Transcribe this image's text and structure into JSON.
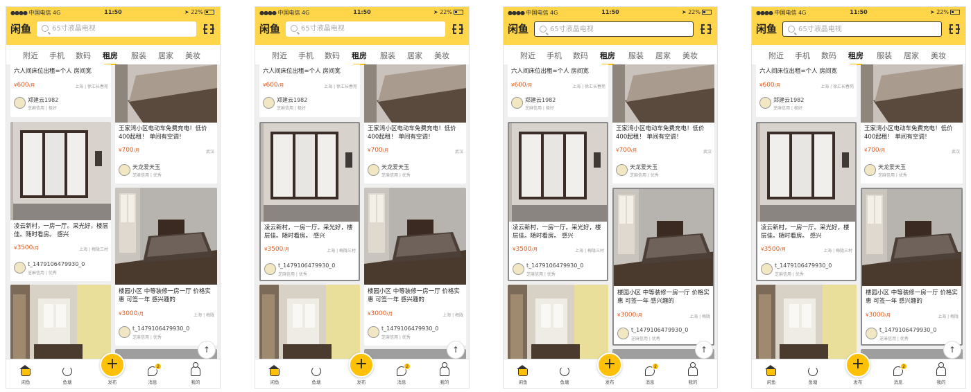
{
  "status": {
    "carrier": "中国电信",
    "network": "4G",
    "time": "11:50",
    "battery": "22%"
  },
  "logo": "闲鱼",
  "search": {
    "placeholder": "65寸液晶电视"
  },
  "tabs": [
    "附近",
    "手机",
    "数码",
    "租房",
    "服装",
    "居家",
    "美妆"
  ],
  "active_tab": "租房",
  "cards": {
    "c1": {
      "title": "六人间床位出租=个人 房间宽",
      "price_yen": "¥",
      "price": "600",
      "unit": "/月",
      "location": "上海 | 徐汇长春苑",
      "user": "郑建云1982",
      "credit": "芝麻信用 | 极好"
    },
    "c2": {
      "title": "王家湾小区电动车免费充电！低价400起租！ 单间有空调！",
      "price_yen": "¥",
      "price": "700",
      "unit": "/月",
      "location": "武汉",
      "user": "天龙爱天玉",
      "credit": "芝麻信用 | 优秀"
    },
    "c3": {
      "title": "凌云新村，一房一厅。采光好，楼层佳。随时看房。 感兴",
      "price_yen": "¥",
      "price": "3500",
      "unit": "/月",
      "location": "上海 | 梅陇三村",
      "user": "t_1479106479930_0",
      "credit": "芝麻信用 | 优秀"
    },
    "c4": {
      "title": "楼园小区 中等装修一房一厅 价格实惠 可签一年 感兴趣的",
      "price_yen": "¥",
      "price": "3000",
      "unit": "/月",
      "location": "上海 | 梅陇",
      "user": "t_1479106479930_0",
      "credit": "芝麻信用 | 优秀"
    }
  },
  "to_top": "↑",
  "tabbar": {
    "home": "闲鱼",
    "pond": "鱼塘",
    "publish": "发布",
    "publish_icon": "+",
    "messages": "消息",
    "messages_badge": "2",
    "me": "我的"
  },
  "frames": [
    {
      "highlight": "none"
    },
    {
      "highlight": "card-c3"
    },
    {
      "highlight": "card-c3, card-c4, search-input"
    },
    {
      "highlight": "card-c3, card-c4, search-input"
    }
  ],
  "colors": {
    "brand_yellow": "#ffd54a",
    "accent_yellow": "#ffc107",
    "price_orange": "#e05a1c",
    "highlight_border": "#8a8a8a"
  }
}
